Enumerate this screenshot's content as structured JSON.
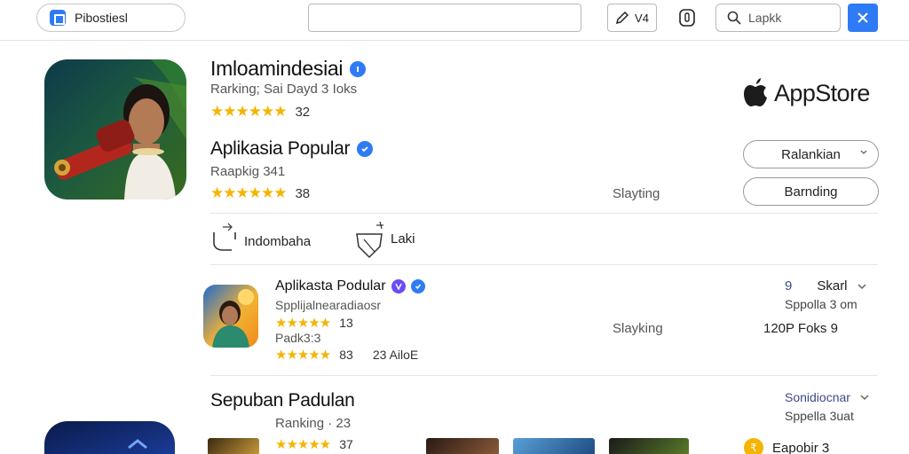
{
  "topbar": {
    "tab_label": "Pibostiesl",
    "tool_label": "V4",
    "search_placeholder": "Lapkk"
  },
  "hero": {
    "title": "Imloamindesiai",
    "ranking": "Rarking; Sai Dayd 3 Ioks",
    "rating_stars": "★★★★★★",
    "rating_count": "32",
    "popular_title": "Aplikasia Popular",
    "popular_ranking": "Raapkig 341",
    "popular_stars": "★★★★★★",
    "popular_count": "38",
    "status_label": "Slayting",
    "store_name": "AppStore",
    "btn_primary": "Ralankian",
    "btn_secondary": "Barnding"
  },
  "actions": {
    "action1": "Indombaha",
    "action2": "Laki"
  },
  "list_item": {
    "title": "Aplikasta Podular",
    "subtitle": "Spplijalnearadiaosr",
    "rating_stars": "★★★★★",
    "rating_value": "13",
    "rank_label": "Padk3:3",
    "rating2_stars": "★★★★★",
    "rating2_value": "83",
    "extra": "23 AiloE",
    "status_label": "Slayking",
    "right_count": "9",
    "right_dropdown": "Skarl",
    "right_sub": "Sppolla 3 om",
    "right_size": "120P Foks 9"
  },
  "section": {
    "title": "Sepuban Padulan",
    "ranking": "Ranking · 23",
    "stars": "★★★★★",
    "count": "37",
    "dropdown": "Sonidiocnar",
    "right_sub": "Sppella 3uat",
    "footer_label": "Eapobir 3"
  },
  "colors": {
    "accent": "#2f7bf5",
    "star": "#f5b400"
  }
}
